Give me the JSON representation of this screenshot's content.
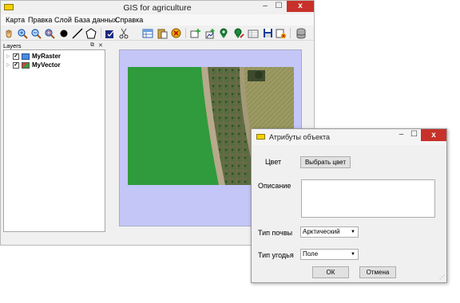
{
  "main_window": {
    "title": "GIS for agriculture",
    "close_glyph": "x",
    "menu": [
      "Карта",
      "Правка",
      "Слой",
      "База данных",
      "Справка"
    ],
    "layers_panel": {
      "title": "Layers",
      "layers": [
        {
          "name": "MyRaster",
          "checked": true,
          "icon": "raster-layer-icon"
        },
        {
          "name": "MyVector",
          "checked": true,
          "icon": "vector-layer-icon"
        }
      ]
    }
  },
  "dialog": {
    "title": "Атрибуты объекта",
    "color_label": "Цвет",
    "choose_color_button": "Выбрать цвет",
    "description_label": "Описание",
    "description_value": "",
    "soil_type_label": "Тип почвы",
    "soil_type_value": "Арктический",
    "land_type_label": "Тип угодья",
    "land_type_value": "Поле",
    "ok_button": "ОК",
    "cancel_button": "Отмена"
  },
  "colors": {
    "map_background": "#c4c6f7",
    "close_button": "#c7312a",
    "field_green": "#2f9b3c"
  }
}
